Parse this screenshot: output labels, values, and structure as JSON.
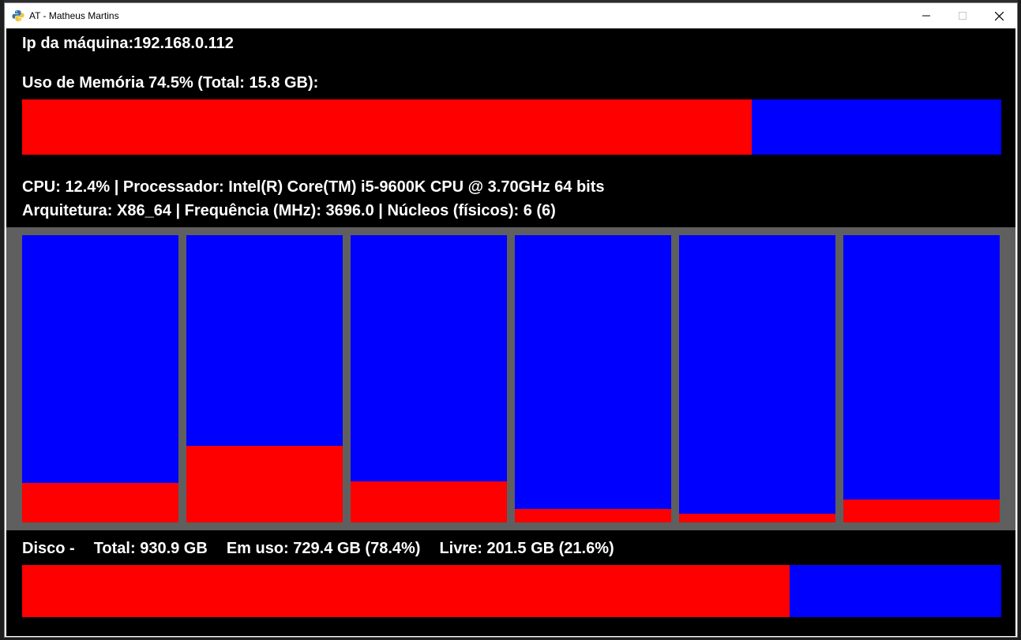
{
  "window": {
    "title": "AT - Matheus Martins",
    "minimize_icon": "minimize-icon",
    "maximize_icon": "maximize-icon",
    "close_icon": "close-icon",
    "app_icon": "python-icon"
  },
  "network": {
    "ip_text": "Ip da máquina:192.168.0.112"
  },
  "memory": {
    "label": "Uso de Memória 74.5% (Total: 15.8 GB):",
    "used_fraction": 0.745
  },
  "cpu": {
    "line1": "CPU: 12.4% | Processador: Intel(R) Core(TM) i5-9600K CPU @ 3.70GHz 64 bits",
    "line2": "Arquitetura: X86_64 | Frequência (MHz): 3696.0 | Núcleos (físicos): 6 (6)",
    "core_usage_fractions": [
      0.137,
      0.267,
      0.143,
      0.048,
      0.031,
      0.079
    ]
  },
  "disk": {
    "title": "Disco -",
    "total": "Total: 930.9 GB",
    "used": "Em uso: 729.4 GB (78.4%)",
    "free": "Livre: 201.5 GB (21.6%)",
    "used_fraction": 0.784
  },
  "colors": {
    "used": "#ff0000",
    "free": "#0000ff",
    "panel": "#5f5f5f",
    "background": "#000000"
  }
}
